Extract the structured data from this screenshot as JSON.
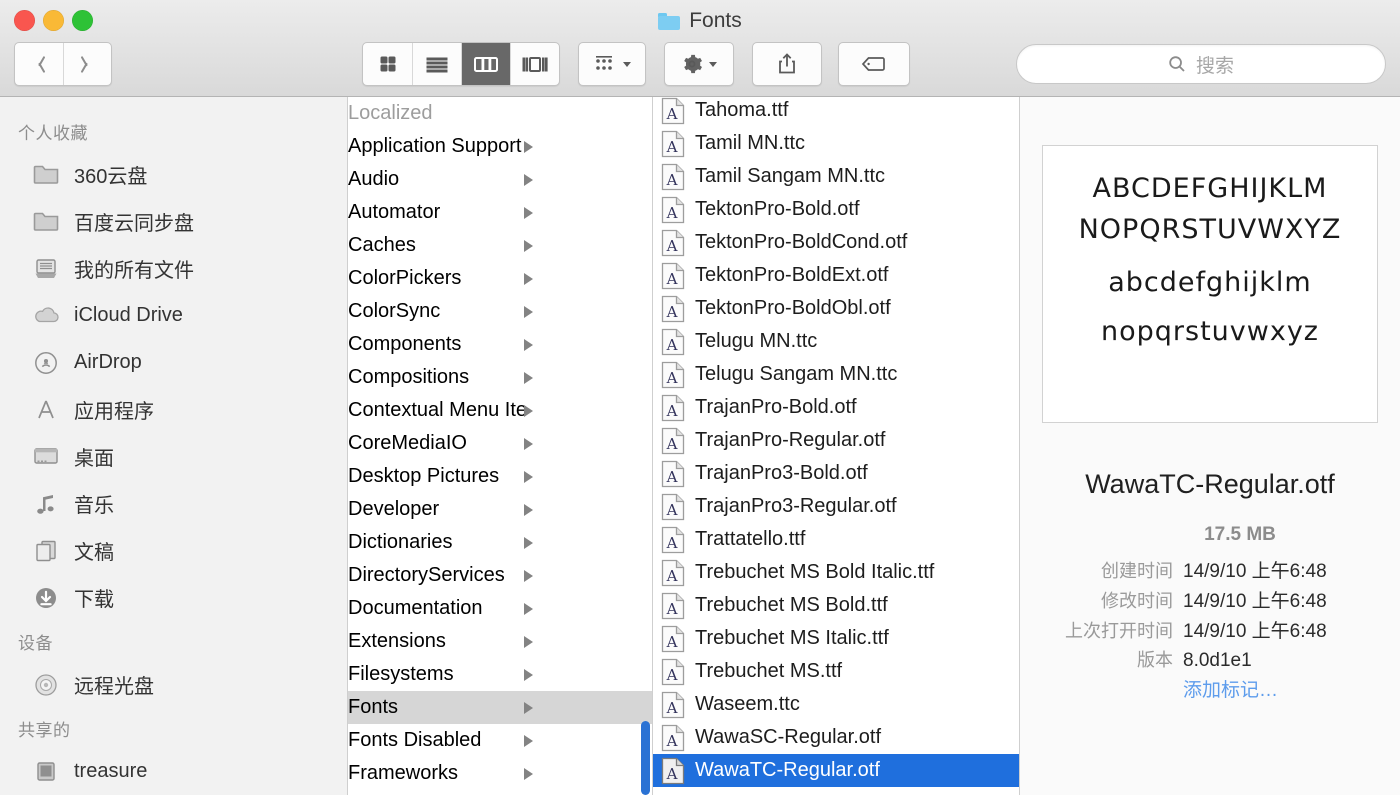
{
  "window": {
    "title": "Fonts",
    "folder_icon": "folder-icon"
  },
  "toolbar": {
    "back_label": "",
    "forward_label": "",
    "views": [
      {
        "name": "icon-view",
        "selected": false
      },
      {
        "name": "list-view",
        "selected": false
      },
      {
        "name": "column-view",
        "selected": true
      },
      {
        "name": "gallery-view",
        "selected": false
      }
    ],
    "arrange_label": "",
    "action_label": "",
    "share_label": "",
    "tags_label": ""
  },
  "search": {
    "placeholder": "搜索",
    "value": ""
  },
  "sidebar": {
    "sections": [
      {
        "header": "个人收藏",
        "items": [
          {
            "label": "360云盘",
            "icon": "folder-icon"
          },
          {
            "label": "百度云同步盘",
            "icon": "folder-icon"
          },
          {
            "label": "我的所有文件",
            "icon": "all-my-files-icon"
          },
          {
            "label": "iCloud Drive",
            "icon": "cloud-icon"
          },
          {
            "label": "AirDrop",
            "icon": "airdrop-icon"
          },
          {
            "label": "应用程序",
            "icon": "applications-icon"
          },
          {
            "label": "桌面",
            "icon": "desktop-icon"
          },
          {
            "label": "音乐",
            "icon": "music-icon"
          },
          {
            "label": "文稿",
            "icon": "documents-icon"
          },
          {
            "label": "下载",
            "icon": "downloads-icon"
          }
        ]
      },
      {
        "header": "设备",
        "items": [
          {
            "label": "远程光盘",
            "icon": "disc-icon"
          }
        ]
      },
      {
        "header": "共享的",
        "items": [
          {
            "label": "treasure",
            "icon": "computer-icon"
          }
        ]
      }
    ]
  },
  "column_middle": {
    "items": [
      {
        "label": "Localized",
        "has_children": false,
        "selected": false,
        "dimmed": true
      },
      {
        "label": "Application Support",
        "has_children": true,
        "selected": false
      },
      {
        "label": "Audio",
        "has_children": true,
        "selected": false
      },
      {
        "label": "Automator",
        "has_children": true,
        "selected": false
      },
      {
        "label": "Caches",
        "has_children": true,
        "selected": false
      },
      {
        "label": "ColorPickers",
        "has_children": true,
        "selected": false
      },
      {
        "label": "ColorSync",
        "has_children": true,
        "selected": false
      },
      {
        "label": "Components",
        "has_children": true,
        "selected": false
      },
      {
        "label": "Compositions",
        "has_children": true,
        "selected": false
      },
      {
        "label": "Contextual Menu Items",
        "has_children": true,
        "selected": false
      },
      {
        "label": "CoreMediaIO",
        "has_children": true,
        "selected": false
      },
      {
        "label": "Desktop Pictures",
        "has_children": true,
        "selected": false
      },
      {
        "label": "Developer",
        "has_children": true,
        "selected": false
      },
      {
        "label": "Dictionaries",
        "has_children": true,
        "selected": false
      },
      {
        "label": "DirectoryServices",
        "has_children": true,
        "selected": false
      },
      {
        "label": "Documentation",
        "has_children": true,
        "selected": false
      },
      {
        "label": "Extensions",
        "has_children": true,
        "selected": false
      },
      {
        "label": "Filesystems",
        "has_children": true,
        "selected": false
      },
      {
        "label": "Fonts",
        "has_children": true,
        "selected": true
      },
      {
        "label": "Fonts Disabled",
        "has_children": true,
        "selected": false
      },
      {
        "label": "Frameworks",
        "has_children": true,
        "selected": false
      }
    ]
  },
  "column_files": {
    "items": [
      {
        "label": "Tahoma.ttf",
        "selected": false
      },
      {
        "label": "Tamil MN.ttc",
        "selected": false
      },
      {
        "label": "Tamil Sangam MN.ttc",
        "selected": false
      },
      {
        "label": "TektonPro-Bold.otf",
        "selected": false
      },
      {
        "label": "TektonPro-BoldCond.otf",
        "selected": false
      },
      {
        "label": "TektonPro-BoldExt.otf",
        "selected": false
      },
      {
        "label": "TektonPro-BoldObl.otf",
        "selected": false
      },
      {
        "label": "Telugu MN.ttc",
        "selected": false
      },
      {
        "label": "Telugu Sangam MN.ttc",
        "selected": false
      },
      {
        "label": "TrajanPro-Bold.otf",
        "selected": false
      },
      {
        "label": "TrajanPro-Regular.otf",
        "selected": false
      },
      {
        "label": "TrajanPro3-Bold.otf",
        "selected": false
      },
      {
        "label": "TrajanPro3-Regular.otf",
        "selected": false
      },
      {
        "label": "Trattatello.ttf",
        "selected": false
      },
      {
        "label": "Trebuchet MS Bold Italic.ttf",
        "selected": false
      },
      {
        "label": "Trebuchet MS Bold.ttf",
        "selected": false
      },
      {
        "label": "Trebuchet MS Italic.ttf",
        "selected": false
      },
      {
        "label": "Trebuchet MS.ttf",
        "selected": false
      },
      {
        "label": "Waseem.ttc",
        "selected": false
      },
      {
        "label": "WawaSC-Regular.otf",
        "selected": false
      },
      {
        "label": "WawaTC-Regular.otf",
        "selected": true
      }
    ]
  },
  "preview": {
    "specimen_lines": [
      "ABCDEFGHIJKLM",
      "NOPQRSTUVWXYZ",
      "abcdefghijklm",
      "nopqrstuvwxyz"
    ],
    "filename": "WawaTC-Regular.otf",
    "size": "17.5 MB",
    "metadata": [
      {
        "key": "创建时间",
        "value": "14/9/10 上午6:48"
      },
      {
        "key": "修改时间",
        "value": "14/9/10 上午6:48"
      },
      {
        "key": "上次打开时间",
        "value": "14/9/10 上午6:48"
      },
      {
        "key": "版本",
        "value": "8.0d1e1"
      }
    ],
    "add_tags": "添加标记…"
  },
  "colors": {
    "selection_blue": "#1f6fdd",
    "scrollbar_blue": "#2a72d4",
    "folder_blue": "#7dcdf2",
    "link_blue": "#5d9cec"
  }
}
